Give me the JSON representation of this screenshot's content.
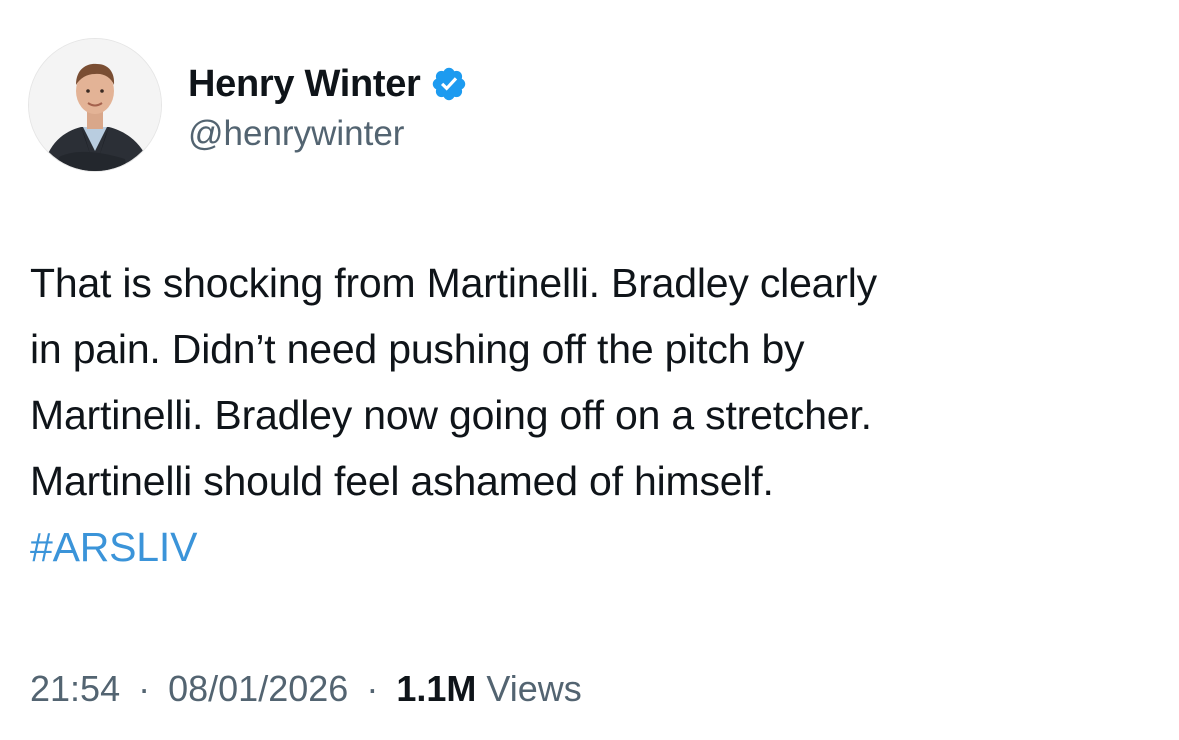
{
  "author": {
    "display_name": "Henry Winter",
    "handle": "@henrywinter",
    "verified": true,
    "verified_color": "#1d9bf0",
    "avatar_icon": "profile-photo-man-in-suit"
  },
  "tweet": {
    "lines": [
      "That is shocking from Martinelli. Bradley clearly",
      "in pain. Didn’t need pushing off the pitch by",
      "Martinelli. Bradley now going off on a stretcher.",
      "Martinelli should feel ashamed of himself."
    ],
    "hashtag": "#ARSLIV",
    "hashtag_color": "#3b94d9"
  },
  "meta": {
    "time": "21:54",
    "separator": "·",
    "date": "08/01/2026",
    "views_count": "1.1M",
    "views_label": "Views"
  }
}
